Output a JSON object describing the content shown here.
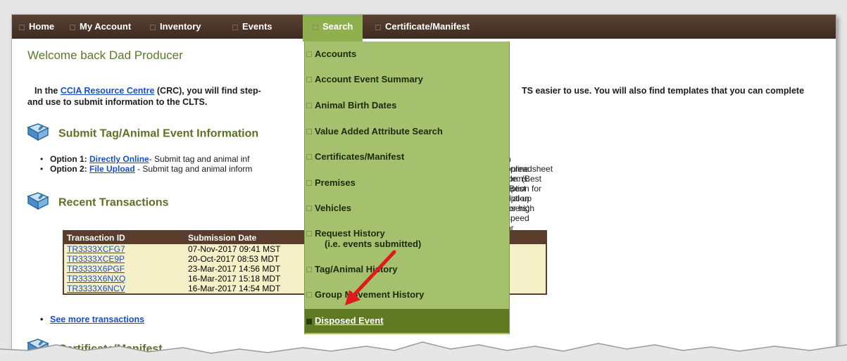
{
  "nav": {
    "items": [
      {
        "label": "Home"
      },
      {
        "label": "My Account"
      },
      {
        "label": "Inventory"
      },
      {
        "label": "Events"
      },
      {
        "label": "Search"
      },
      {
        "label": "Certificate/Manifest"
      }
    ],
    "active_color": "#8fb04f",
    "bar_color": "#4a3428"
  },
  "welcome": "Welcome back  Dad Producer",
  "intro": {
    "line1_start": "In the ",
    "link": "CCIA Resource Centre",
    "line1_mid": " (CRC), you will find step-",
    "line1_end": "TS easier to use. You will also find templates that you can complete",
    "line2": "and use to submit information to the CLTS."
  },
  "sections": {
    "submit": "Submit Tag/Animal Event Information",
    "recent": "Recent Transactions",
    "certificate": "Certificate/Manifest"
  },
  "options": [
    {
      "prefix": "Option 1: ",
      "link": "Directly Online",
      "text": "- Submit tag and animal inf",
      "right": "n online forms. (Best option for high speed or satellite users)"
    },
    {
      "prefix": "Option 2: ",
      "link": "File Upload",
      "text": " - Submit tag and animal inform",
      "right": "spreadsheet file. (Best option for dial-up users)"
    }
  ],
  "transactions": {
    "headers": [
      "Transaction ID",
      "Submission Date"
    ],
    "rows": [
      {
        "id": "TR3333XCFG7",
        "date": "07-Nov-2017 09:41 MST"
      },
      {
        "id": "TR3333XCE9P",
        "date": "20-Oct-2017 08:53 MDT"
      },
      {
        "id": "TR3333X6PGF",
        "date": "23-Mar-2017 14:56 MDT"
      },
      {
        "id": "TR3333X6NXQ",
        "date": "16-Mar-2017 15:18 MDT"
      },
      {
        "id": "TR3333X6NCV",
        "date": "16-Mar-2017 14:54 MDT"
      }
    ]
  },
  "see_more": "See more transactions",
  "search_menu": {
    "items": [
      {
        "label": "Accounts"
      },
      {
        "label": "Account Event Summary"
      },
      {
        "label": "Animal Birth Dates"
      },
      {
        "label": "Value Added Attribute Search"
      },
      {
        "label": "Certificates/Manifest"
      },
      {
        "label": "Premises"
      },
      {
        "label": "Vehicles"
      },
      {
        "label": "Request History",
        "sub": "(i.e. events submitted)"
      },
      {
        "label": "Tag/Animal History"
      },
      {
        "label": "Group Movement History"
      },
      {
        "label": "Disposed Event",
        "active": true
      }
    ],
    "menu_color": "#a5c16d",
    "active_color": "#5f7a22"
  },
  "annotation_color": "#e0191b",
  "icons": {
    "book": "book-icon",
    "arrow": "red-arrow-annotation"
  }
}
